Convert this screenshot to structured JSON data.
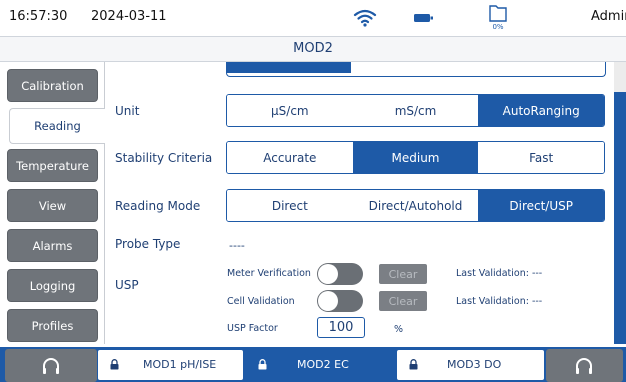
{
  "status": {
    "time": "16:57:30",
    "date": "2024-03-11",
    "storage_pct": "0%",
    "user": "Admin"
  },
  "title": "MOD2",
  "tabs": [
    {
      "label": "Calibration",
      "active": false
    },
    {
      "label": "Reading",
      "active": true
    },
    {
      "label": "Temperature",
      "active": false
    },
    {
      "label": "View",
      "active": false
    },
    {
      "label": "Alarms",
      "active": false
    },
    {
      "label": "Logging",
      "active": false
    },
    {
      "label": "Profiles",
      "active": false
    }
  ],
  "settings": {
    "unit": {
      "label": "Unit",
      "options": [
        "µS/cm",
        "mS/cm",
        "AutoRanging"
      ],
      "selected": "AutoRanging"
    },
    "stability": {
      "label": "Stability Criteria",
      "options": [
        "Accurate",
        "Medium",
        "Fast"
      ],
      "selected": "Medium"
    },
    "reading_mode": {
      "label": "Reading Mode",
      "options": [
        "Direct",
        "Direct/Autohold",
        "Direct/USP"
      ],
      "selected": "Direct/USP"
    },
    "probe_type": {
      "label": "Probe Type",
      "value": "----"
    },
    "usp": {
      "label": "USP",
      "meter_verification": "Meter Verification",
      "cell_validation": "Cell Validation",
      "clear_label": "Clear",
      "last_validation": "Last Validation: ---",
      "factor_label": "USP Factor",
      "factor_value": "100",
      "factor_unit": "%"
    }
  },
  "modules": [
    {
      "label": "MOD1 pH/ISE",
      "active": false
    },
    {
      "label": "MOD2 EC",
      "active": true
    },
    {
      "label": "MOD3 DO",
      "active": false
    }
  ],
  "colors": {
    "accent": "#1e5aa7",
    "tab_inactive": "#6f747a",
    "text": "#1f3f73"
  }
}
